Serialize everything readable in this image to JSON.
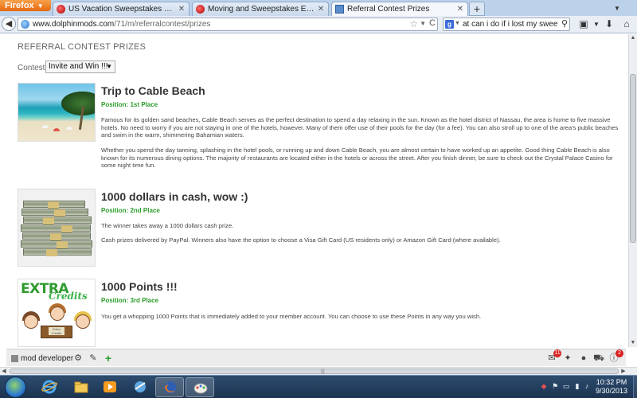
{
  "browser": {
    "app_button": "Firefox",
    "tabs": [
      {
        "label": "US Vacation Sweepstakes List - Swee..."
      },
      {
        "label": "Moving and Sweepstakes Entries - W..."
      },
      {
        "label": "Referral Contest Prizes"
      }
    ],
    "url_host": "www.dolphinmods.com",
    "url_path": "/71/m/referralcontest/prizes",
    "search_value": "at can i do if i lost my sweeptake"
  },
  "page": {
    "heading": "REFERRAL CONTEST PRIZES",
    "contests_label": "Contests",
    "contests_selected": "Invite and Win !!!",
    "prizes": [
      {
        "title": "Trip to Cable Beach",
        "position": "Position: 1st Place",
        "paragraphs": [
          "Famous for its golden sand beaches, Cable Beach serves as the perfect destination to spend a day relaxing in the sun. Known as the hotel district of Nassau, the area is home to five massive hotels. No need to worry if you are not staying in one of the hotels, however. Many of them offer use of their pools for the day (for a fee). You can also stroll up to one of the area's public beaches and swim in the warm, shimmering Bahamian waters.",
          "Whether you spend the day tanning, splashing in the hotel pools, or running up and down Cable Beach, you are almost certain to have worked up an appetite. Good thing Cable Beach is also known  for its numerous dining options. The majority of restaurants are located either in the hotels or across the street. After you finish dinner, be sure to check out the Crystal Palace Casino for some night time fun."
        ]
      },
      {
        "title": "1000 dollars in cash, wow :)",
        "position": "Position: 2nd Place",
        "paragraphs": [
          "The winner takes away a 1000 dollars cash prize.",
          "Cash prizes delivered by PayPal. Winners also have the option to choose a Visa Gift Card (US residents only) or Amazon Gift Card (where available)."
        ]
      },
      {
        "title": "1000 Points !!!",
        "position": "Position: 3rd Place",
        "paragraphs": [
          "You get a whopping 1000 Points that is immediately added to your member account. You can choose to use these Points in any way you wish."
        ]
      }
    ],
    "image_text": {
      "logo_main": "EXTRA",
      "logo_sub": "Credits",
      "booth_sign": "Extra Credits"
    }
  },
  "site_toolbar": {
    "user_label": "mod developer",
    "mail_badge": "11",
    "info_badge": "2"
  },
  "taskbar": {
    "time": "10:32 PM",
    "date": "9/30/2013"
  },
  "colors": {
    "position_green": "#2a9d2a",
    "tab_bar": "#bcd1ea",
    "taskbar": "#1b3350"
  },
  "icons": {
    "toolbar": [
      "gear-icon",
      "edit-icon",
      "plus-icon",
      "mail-icon",
      "twitter-icon",
      "user-icon",
      "cart-icon",
      "info-icon"
    ],
    "nav": [
      "back-icon",
      "star-icon",
      "reload-icon",
      "search-icon",
      "screenshot-icon",
      "download-icon",
      "home-icon"
    ]
  }
}
